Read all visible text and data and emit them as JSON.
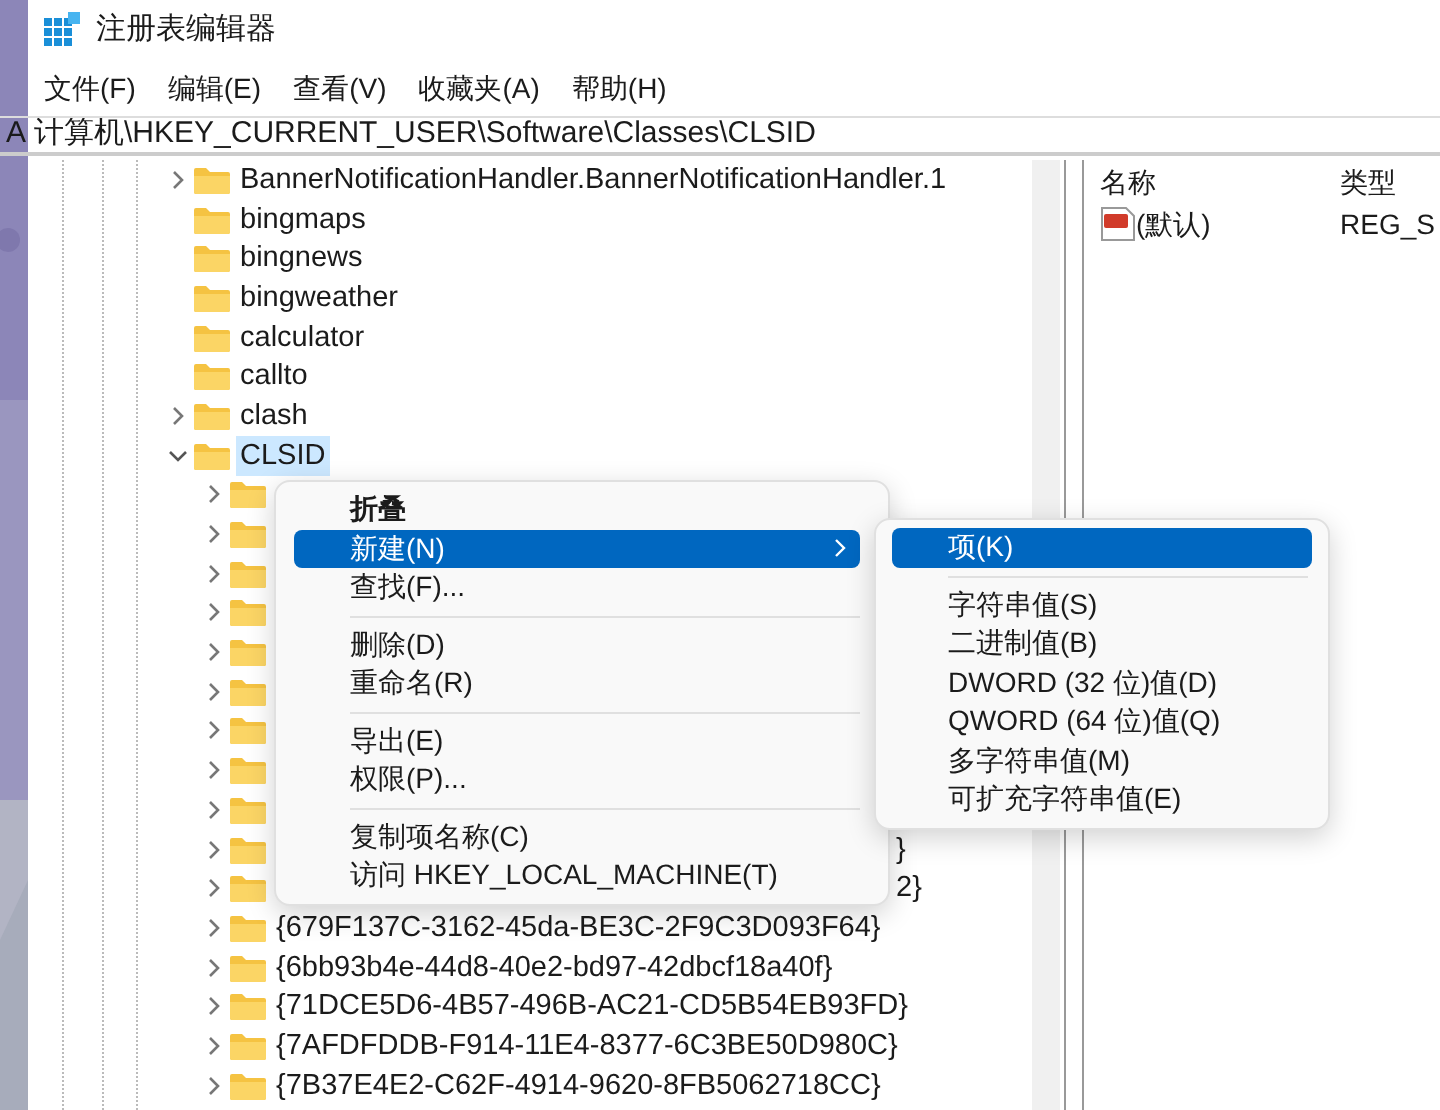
{
  "window": {
    "title": "注册表编辑器"
  },
  "menu_bar": [
    {
      "label": "文件(F)"
    },
    {
      "label": "编辑(E)"
    },
    {
      "label": "查看(V)"
    },
    {
      "label": "收藏夹(A)"
    },
    {
      "label": "帮助(H)"
    }
  ],
  "address_bar": {
    "prefix": "A",
    "path": "计算机\\HKEY_CURRENT_USER\\Software\\Classes\\CLSID"
  },
  "tree": {
    "items": [
      {
        "label": "BannerNotificationHandler.BannerNotificationHandler.1",
        "has_children": true,
        "expanded": false,
        "selected": false
      },
      {
        "label": "bingmaps",
        "has_children": false,
        "expanded": false,
        "selected": false
      },
      {
        "label": "bingnews",
        "has_children": false,
        "expanded": false,
        "selected": false
      },
      {
        "label": "bingweather",
        "has_children": false,
        "expanded": false,
        "selected": false
      },
      {
        "label": "calculator",
        "has_children": false,
        "expanded": false,
        "selected": false
      },
      {
        "label": "callto",
        "has_children": false,
        "expanded": false,
        "selected": false
      },
      {
        "label": "clash",
        "has_children": true,
        "expanded": false,
        "selected": false
      },
      {
        "label": "CLSID",
        "has_children": true,
        "expanded": true,
        "selected": true,
        "children": [
          {
            "has_children": true,
            "expanded": false,
            "selected": false
          },
          {
            "has_children": true,
            "expanded": false,
            "selected": false
          },
          {
            "has_children": true,
            "expanded": false,
            "selected": false
          },
          {
            "has_children": true,
            "expanded": false,
            "selected": false
          },
          {
            "has_children": true,
            "expanded": false,
            "selected": false
          },
          {
            "has_children": true,
            "expanded": false,
            "selected": false
          },
          {
            "has_children": true,
            "expanded": false,
            "selected": false
          },
          {
            "has_children": true,
            "expanded": false,
            "selected": false
          },
          {
            "has_children": true,
            "expanded": false,
            "selected": false
          },
          {
            "has_children": true,
            "expanded": false,
            "selected": false,
            "tail": "}"
          },
          {
            "has_children": true,
            "expanded": false,
            "selected": false,
            "tail": "2}"
          },
          {
            "label": "{679F137C-3162-45da-BE3C-2F9C3D093F64}",
            "has_children": true,
            "expanded": false,
            "selected": false
          },
          {
            "label": "{6bb93b4e-44d8-40e2-bd97-42dbcf18a40f}",
            "has_children": true,
            "expanded": false,
            "selected": false
          },
          {
            "label": "{71DCE5D6-4B57-496B-AC21-CD5B54EB93FD}",
            "has_children": true,
            "expanded": false,
            "selected": false
          },
          {
            "label": "{7AFDFDDB-F914-11E4-8377-6C3BE50D980C}",
            "has_children": true,
            "expanded": false,
            "selected": false
          },
          {
            "label": "{7B37E4E2-C62F-4914-9620-8FB5062718CC}",
            "has_children": true,
            "expanded": false,
            "selected": false
          }
        ]
      }
    ]
  },
  "values_pane": {
    "columns": [
      "名称",
      "类型"
    ],
    "rows": [
      {
        "name": "(默认)",
        "type": "REG_S"
      }
    ]
  },
  "context_menu": {
    "items": [
      {
        "kind": "item",
        "label": "折叠",
        "is_default": true,
        "selected": false,
        "submenu": false
      },
      {
        "kind": "item",
        "label": "新建(N)",
        "is_default": false,
        "selected": true,
        "submenu": true
      },
      {
        "kind": "item",
        "label": "查找(F)...",
        "is_default": false,
        "selected": false,
        "submenu": false
      },
      {
        "kind": "separator"
      },
      {
        "kind": "item",
        "label": "删除(D)",
        "is_default": false,
        "selected": false,
        "submenu": false
      },
      {
        "kind": "item",
        "label": "重命名(R)",
        "is_default": false,
        "selected": false,
        "submenu": false
      },
      {
        "kind": "separator"
      },
      {
        "kind": "item",
        "label": "导出(E)",
        "is_default": false,
        "selected": false,
        "submenu": false
      },
      {
        "kind": "item",
        "label": "权限(P)...",
        "is_default": false,
        "selected": false,
        "submenu": false
      },
      {
        "kind": "separator"
      },
      {
        "kind": "item",
        "label": "复制项名称(C)",
        "is_default": false,
        "selected": false,
        "submenu": false
      },
      {
        "kind": "item",
        "label": "访问 HKEY_LOCAL_MACHINE(T)",
        "is_default": false,
        "selected": false,
        "submenu": false
      }
    ]
  },
  "submenu": {
    "items": [
      {
        "kind": "item",
        "label": "项(K)",
        "selected": true
      },
      {
        "kind": "separator"
      },
      {
        "kind": "item",
        "label": "字符串值(S)",
        "selected": false
      },
      {
        "kind": "item",
        "label": "二进制值(B)",
        "selected": false
      },
      {
        "kind": "item",
        "label": "DWORD (32 位)值(D)",
        "selected": false
      },
      {
        "kind": "item",
        "label": "QWORD (64 位)值(Q)",
        "selected": false
      },
      {
        "kind": "item",
        "label": "多字符串值(M)",
        "selected": false
      },
      {
        "kind": "item",
        "label": "可扩充字符串值(E)",
        "selected": false
      }
    ]
  }
}
